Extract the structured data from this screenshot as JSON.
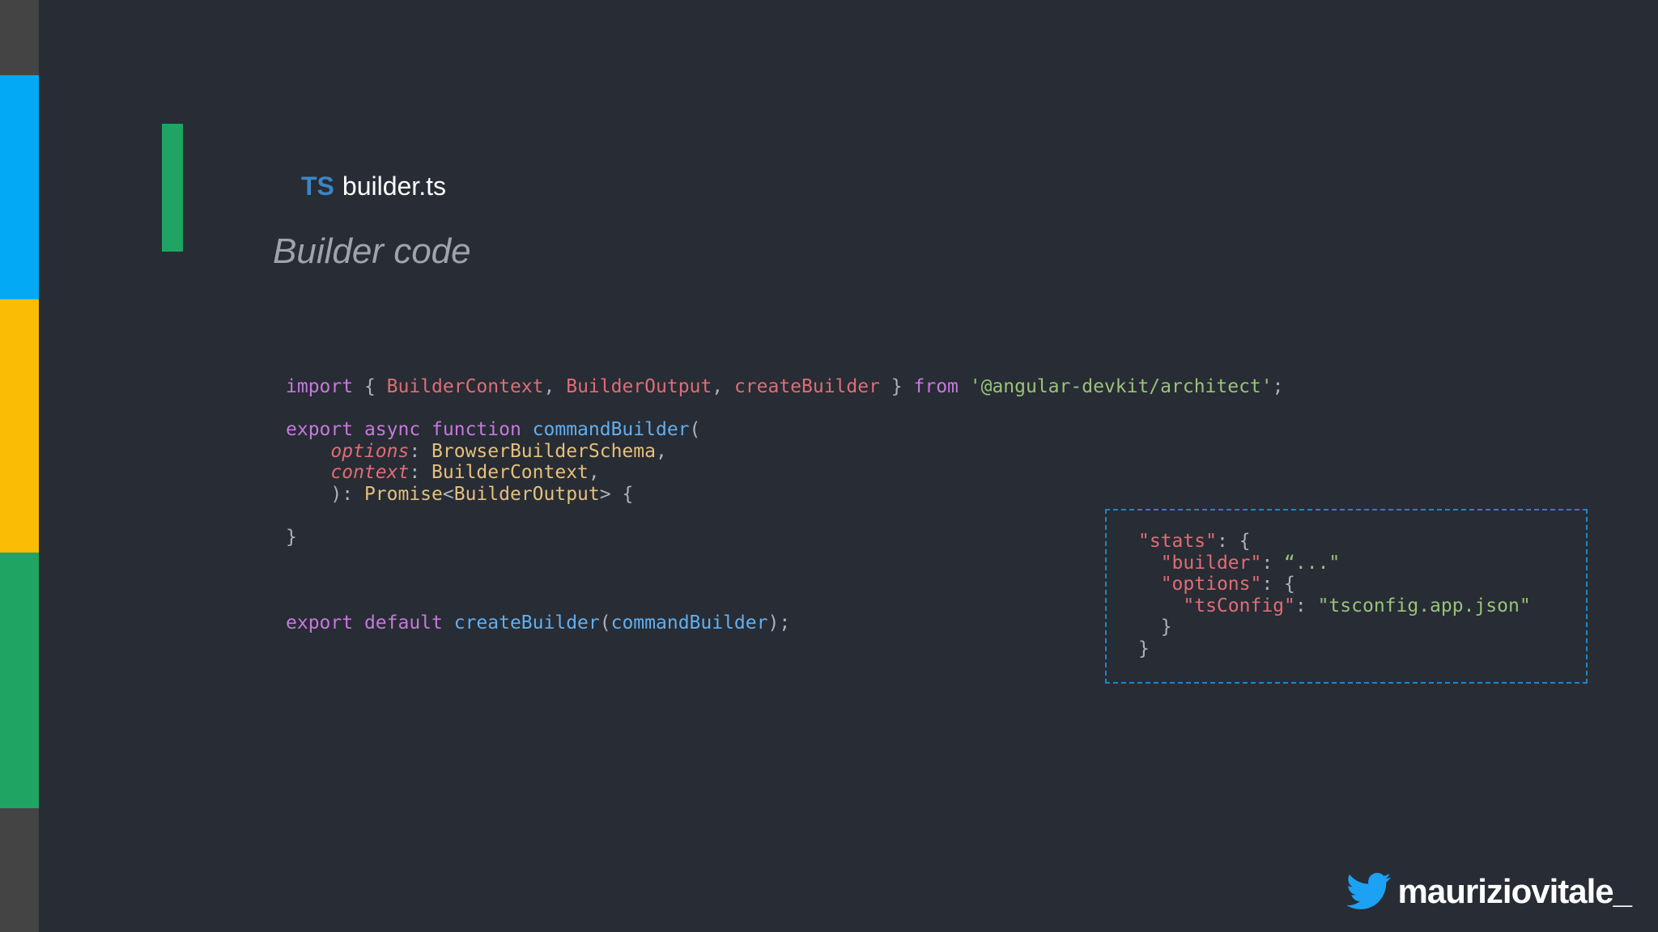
{
  "colors": {
    "background": "#282c34",
    "sidebar_stripes": [
      "#444444",
      "#03a9f4",
      "#fbbc05",
      "#1fa463",
      "#444444"
    ],
    "accent_bar": "#1fa463",
    "json_box_border": "#1f86c4",
    "twitter": "#1da1f2"
  },
  "header": {
    "lang_badge": "TS",
    "filename": "builder.ts",
    "subtitle": "Builder code"
  },
  "code": {
    "line1": {
      "import": "import",
      "brace_open": " { ",
      "t1": "BuilderContext",
      "c1": ", ",
      "t2": "BuilderOutput",
      "c2": ", ",
      "t3": "createBuilder",
      "brace_close": " } ",
      "from": "from",
      "space": " ",
      "module": "'@angular-devkit/architect'",
      "semi": ";"
    },
    "line2": {
      "export": "export",
      "async": " async",
      "function": " function",
      "name": " commandBuilder",
      "paren": "("
    },
    "line3": {
      "indent": "    ",
      "param": "options",
      "colon": ": ",
      "type": "BrowserBuilderSchema",
      "comma": ","
    },
    "line4": {
      "indent": "    ",
      "param": "context",
      "colon": ": ",
      "type": "BuilderContext",
      "comma": ","
    },
    "line5": {
      "prefix": "    ): ",
      "promise": "Promise",
      "lt": "<",
      "type": "BuilderOutput",
      "gt": "> {"
    },
    "line6": "}",
    "line7": {
      "export": "export",
      "default": " default",
      "call": " createBuilder",
      "paren_open": "(",
      "arg": "commandBuilder",
      "paren_close": ");"
    }
  },
  "json_snippet": {
    "l1_key": "\"stats\"",
    "l1_rest": ": {",
    "l2_indent": "  ",
    "l2_key": "\"builder\"",
    "l2_colon": ": ",
    "l2_value": "“...\"",
    "l3_indent": "  ",
    "l3_key": "\"options\"",
    "l3_rest": ": {",
    "l4_indent": "    ",
    "l4_key": "\"tsConfig\"",
    "l4_colon": ": ",
    "l4_value": "\"tsconfig.app.json\"",
    "l5": "  }",
    "l6": "}"
  },
  "footer": {
    "icon": "twitter-icon",
    "handle": "mauriziovitale_"
  }
}
